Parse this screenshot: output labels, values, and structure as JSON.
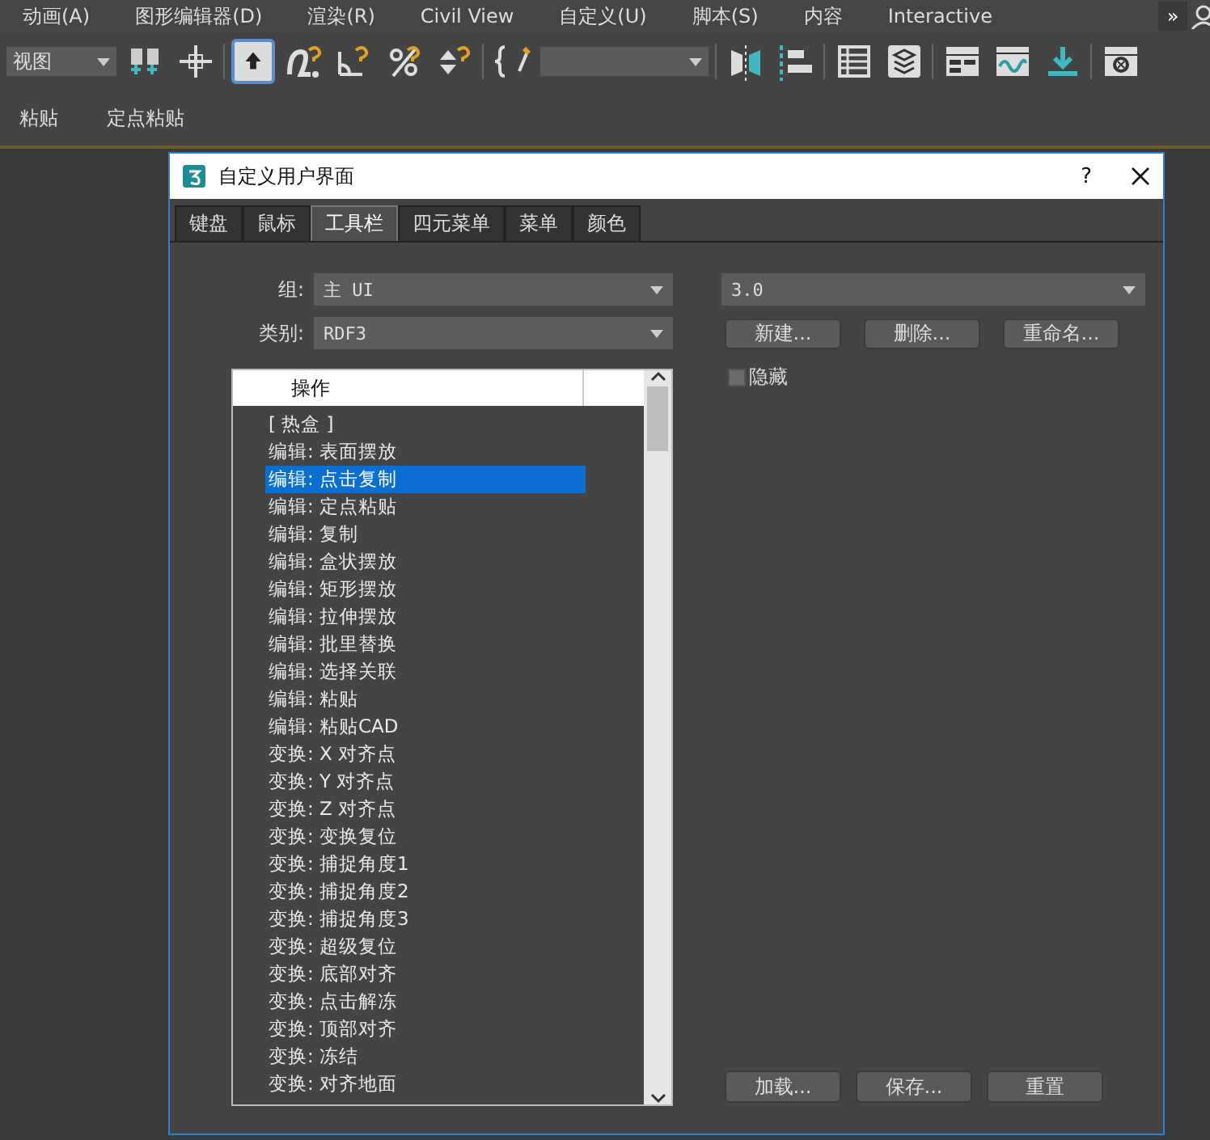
{
  "menu_bar": {
    "items": [
      "动画(A)",
      "图形编辑器(D)",
      "渲染(R)",
      "Civil View",
      "自定义(U)",
      "脚本(S)",
      "内容",
      "Interactive"
    ],
    "overflow": "»"
  },
  "toolbar": {
    "view_dropdown": "视图",
    "tools": [
      {
        "kind": "link",
        "selected": false
      },
      {
        "kind": "move",
        "selected": false
      },
      {
        "kind": "snap-toggle",
        "selected": true
      },
      {
        "kind": "snap",
        "selected": false
      },
      {
        "kind": "angle",
        "selected": false
      },
      {
        "kind": "percent",
        "selected": false
      },
      {
        "kind": "spinner",
        "selected": false
      },
      {
        "kind": "brace",
        "selected": false
      },
      {
        "kind": "dropdown",
        "selected": false
      },
      {
        "kind": "mirror",
        "selected": false
      },
      {
        "kind": "align",
        "selected": false
      },
      {
        "kind": "list",
        "selected": false
      },
      {
        "kind": "layers",
        "selected": false
      },
      {
        "kind": "panel",
        "selected": false
      },
      {
        "kind": "curve",
        "selected": false
      },
      {
        "kind": "download",
        "selected": false
      },
      {
        "kind": "render",
        "selected": false
      }
    ]
  },
  "sub_toolbar": {
    "items": [
      "粘贴",
      "定点粘贴"
    ]
  },
  "dialog": {
    "title": "自定义用户界面",
    "help": "?",
    "tabs": [
      {
        "label": "键盘",
        "selected": false
      },
      {
        "label": "鼠标",
        "selected": false
      },
      {
        "label": "工具栏",
        "selected": true
      },
      {
        "label": "四元菜单",
        "selected": false
      },
      {
        "label": "菜单",
        "selected": false
      },
      {
        "label": "颜色",
        "selected": false
      }
    ],
    "group": {
      "label": "组:",
      "value": "主 UI"
    },
    "category": {
      "label": "类别:",
      "value": "RDF3"
    },
    "action_list": {
      "header": "操作",
      "items": [
        {
          "text": "[ 热盒 ]",
          "selected": false
        },
        {
          "text": "编辑: 表面摆放",
          "selected": false
        },
        {
          "text": "编辑: 点击复制",
          "selected": true
        },
        {
          "text": "编辑: 定点粘贴",
          "selected": false
        },
        {
          "text": "编辑: 复制",
          "selected": false
        },
        {
          "text": "编辑: 盒状摆放",
          "selected": false
        },
        {
          "text": "编辑: 矩形摆放",
          "selected": false
        },
        {
          "text": "编辑: 拉伸摆放",
          "selected": false
        },
        {
          "text": "编辑: 批里替换",
          "selected": false
        },
        {
          "text": "编辑: 选择关联",
          "selected": false
        },
        {
          "text": "编辑: 粘贴",
          "selected": false
        },
        {
          "text": "编辑: 粘贴CAD",
          "selected": false
        },
        {
          "text": "变换: X 对齐点",
          "selected": false
        },
        {
          "text": "变换: Y 对齐点",
          "selected": false
        },
        {
          "text": "变换: Z 对齐点",
          "selected": false
        },
        {
          "text": "变换: 变换复位",
          "selected": false
        },
        {
          "text": "变换: 捕捉角度1",
          "selected": false
        },
        {
          "text": "变换: 捕捉角度2",
          "selected": false
        },
        {
          "text": "变换: 捕捉角度3",
          "selected": false
        },
        {
          "text": "变换: 超级复位",
          "selected": false
        },
        {
          "text": "变换: 底部对齐",
          "selected": false
        },
        {
          "text": "变换: 点击解冻",
          "selected": false
        },
        {
          "text": "变换: 顶部对齐",
          "selected": false
        },
        {
          "text": "变换: 冻结",
          "selected": false
        },
        {
          "text": "变换: 对齐地面",
          "selected": false
        }
      ]
    },
    "toolbar_dropdown": "3.0",
    "toolbar_buttons": [
      "新建...",
      "删除...",
      "重命名..."
    ],
    "hidden_checkbox": {
      "label": "隐藏",
      "checked": false
    },
    "bottom_buttons": [
      "加载...",
      "保存...",
      "重置"
    ]
  }
}
